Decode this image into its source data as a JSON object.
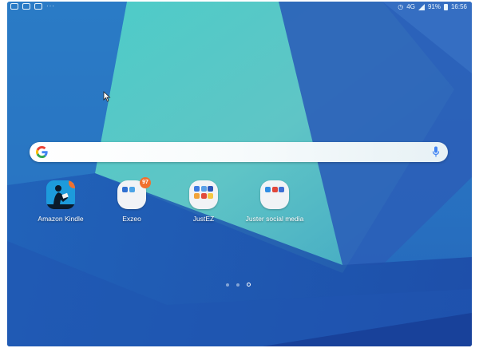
{
  "status_bar": {
    "left_icons": [
      "notification-icon",
      "notification-icon",
      "notification-icon"
    ],
    "overflow": "···",
    "network": "4G",
    "battery": "91%",
    "time": "16:56"
  },
  "search_bar": {
    "logo": "google-g-icon",
    "mic": "microphone-icon"
  },
  "apps": [
    {
      "label": "Amazon Kindle",
      "badge": "1"
    },
    {
      "label": "Exzeo",
      "badge": "97"
    },
    {
      "label": "JustEZ",
      "badge": ""
    },
    {
      "label": "Juster social media",
      "badge": ""
    }
  ],
  "pager": {
    "pages": 3,
    "active": 3
  }
}
